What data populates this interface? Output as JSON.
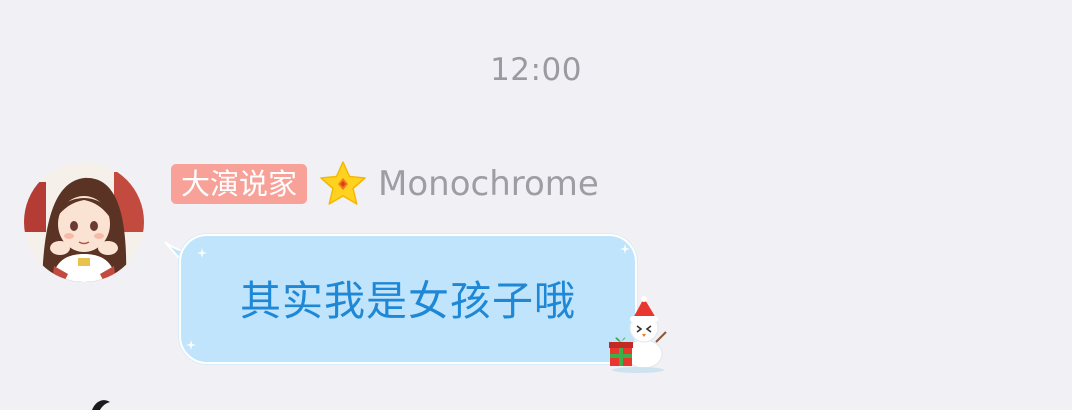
{
  "chat": {
    "timestamp": "12:00",
    "message": {
      "sender": {
        "title_badge": "大演说家",
        "level_icon": "star-icon",
        "username": "Monochrome",
        "avatar": "avatar"
      },
      "text": "其实我是女孩子哦",
      "bubble_color": "#bfe4fb",
      "text_color": "#1e88d6",
      "decoration": "snowman-icon"
    }
  }
}
